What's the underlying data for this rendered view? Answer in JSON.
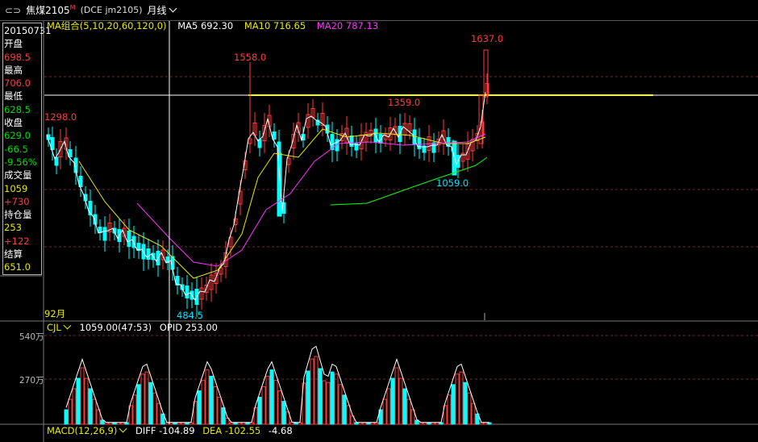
{
  "toolbar": {
    "back_icon": "link-icon",
    "instrument": "焦煤2105",
    "instrument_mark": "M",
    "code": "(DCE jm2105)",
    "period": "月线"
  },
  "info_panel": {
    "date": "20150731",
    "open_label": "开盘",
    "open": "698.5",
    "high_label": "最高",
    "high": "706.0",
    "low_label": "最低",
    "low": "628.5",
    "close_label": "收盘",
    "close": "629.0",
    "change": "-66.5",
    "change_pct": "-9.56%",
    "volume_label": "成交量",
    "volume": "1059",
    "volume_change": "+730",
    "oi_label": "持仓量",
    "oi": "253",
    "oi_change": "+122",
    "settle_label": "结算",
    "settle": "651.0"
  },
  "ma_legend": {
    "group": "MA组合(5,10,20,60,120,0)",
    "ma5": "MA5 692.30",
    "ma10": "MA10 716.65",
    "ma20": "MA20 787.13"
  },
  "price_labels": {
    "high1": "1558.0",
    "high2": "1637.0",
    "left": "1298.0",
    "mid": "1359.0",
    "low1": "484.5",
    "low2": "1059.0",
    "year_mark": "92月"
  },
  "cjl_panel": {
    "name": "CJL",
    "value": "1059.00(47:53)",
    "opid": "OPID 253.00",
    "axis_top": "540万",
    "axis_mid": "270万"
  },
  "macd_panel": {
    "name": "MACD(12,26,9)",
    "diff": "DIFF -104.89",
    "dea": "DEA -102.55",
    "macd": "-4.68"
  },
  "colors": {
    "up": "#ff3b3b",
    "down": "#00ffff",
    "ma5": "#ffffff",
    "ma10": "#e8e800",
    "ma20": "#ff33ff",
    "ma60": "#00ff00",
    "crosshair": "#ffffff",
    "hline": "#ffff00"
  }
}
